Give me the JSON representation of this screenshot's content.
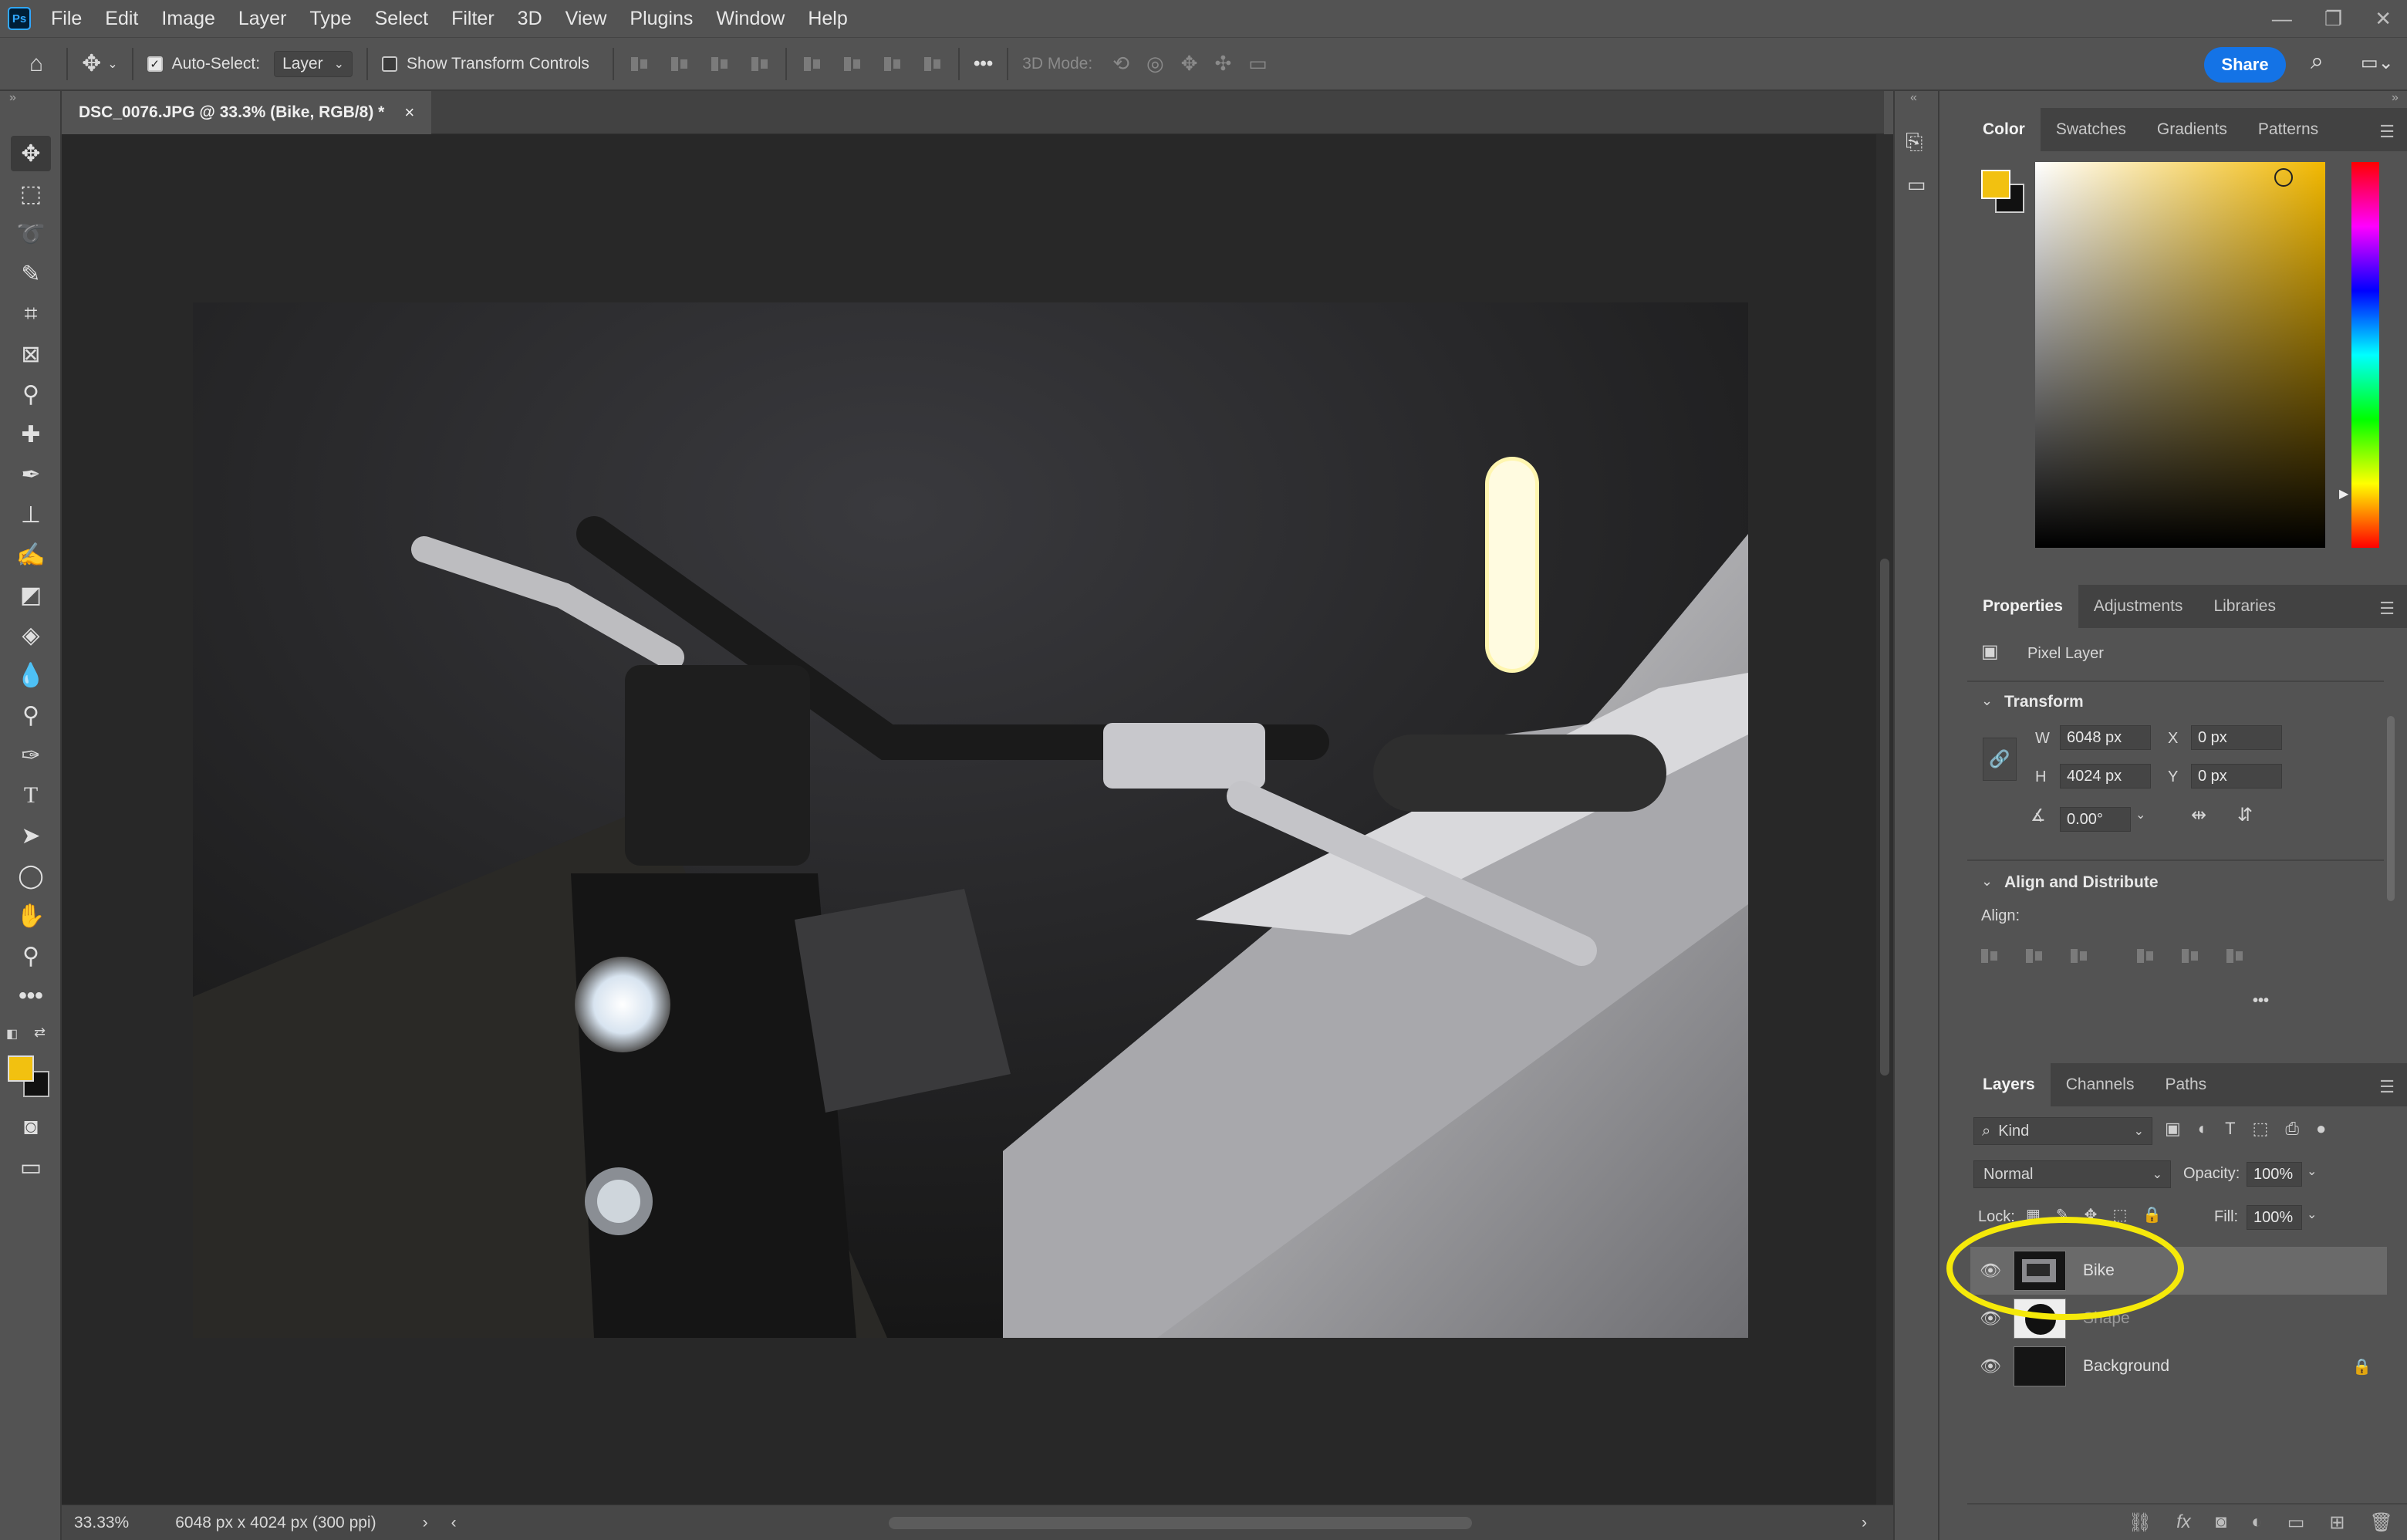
{
  "app": {
    "logo": "Ps"
  },
  "menu": [
    "File",
    "Edit",
    "Image",
    "Layer",
    "Type",
    "Select",
    "Filter",
    "3D",
    "View",
    "Plugins",
    "Window",
    "Help"
  ],
  "options": {
    "auto_select_label": "Auto-Select:",
    "auto_select_value": "Layer",
    "show_transform_label": "Show Transform Controls",
    "more": "•••",
    "mode_label": "3D Mode:",
    "share_label": "Share"
  },
  "document": {
    "tab_title": "DSC_0076.JPG @ 33.3% (Bike, RGB/8) *",
    "close": "×",
    "zoom": "33.33%",
    "info": "6048 px x 4024 px (300 ppi)"
  },
  "color_panel": {
    "tabs": [
      "Color",
      "Swatches",
      "Gradients",
      "Patterns"
    ],
    "foreground": "#F2C110",
    "background": "#111111"
  },
  "properties": {
    "tabs": [
      "Properties",
      "Adjustments",
      "Libraries"
    ],
    "kind": "Pixel Layer",
    "transform_title": "Transform",
    "w_label": "W",
    "w_value": "6048 px",
    "h_label": "H",
    "h_value": "4024 px",
    "x_label": "X",
    "x_value": "0 px",
    "y_label": "Y",
    "y_value": "0 px",
    "angle_value": "0.00°",
    "align_title": "Align and Distribute",
    "align_label": "Align:",
    "more": "•••"
  },
  "layers_panel": {
    "tabs": [
      "Layers",
      "Channels",
      "Paths"
    ],
    "filter_label": "Kind",
    "blend_mode": "Normal",
    "opacity_label": "Opacity:",
    "opacity_value": "100%",
    "lock_label": "Lock:",
    "fill_label": "Fill:",
    "fill_value": "100%",
    "layers": [
      {
        "name": "Bike",
        "selected": true
      },
      {
        "name": "Shape",
        "selected": false
      },
      {
        "name": "Background",
        "selected": false,
        "locked": true
      }
    ]
  },
  "annotation": {
    "highlight_color": "#F5E90A"
  }
}
